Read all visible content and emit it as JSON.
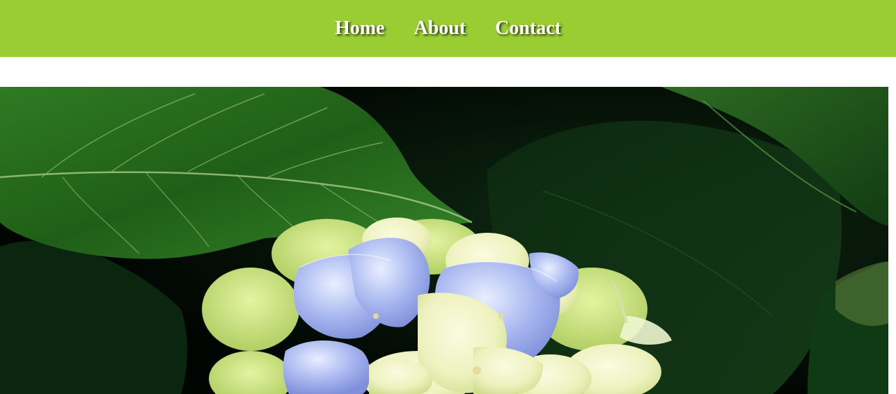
{
  "nav": {
    "items": [
      {
        "label": "Home"
      },
      {
        "label": "About"
      },
      {
        "label": "Contact"
      }
    ],
    "background_color": "#9acd32",
    "text_color": "#ffffff"
  },
  "hero": {
    "image_subject": "hydrangea-flower-photo"
  }
}
